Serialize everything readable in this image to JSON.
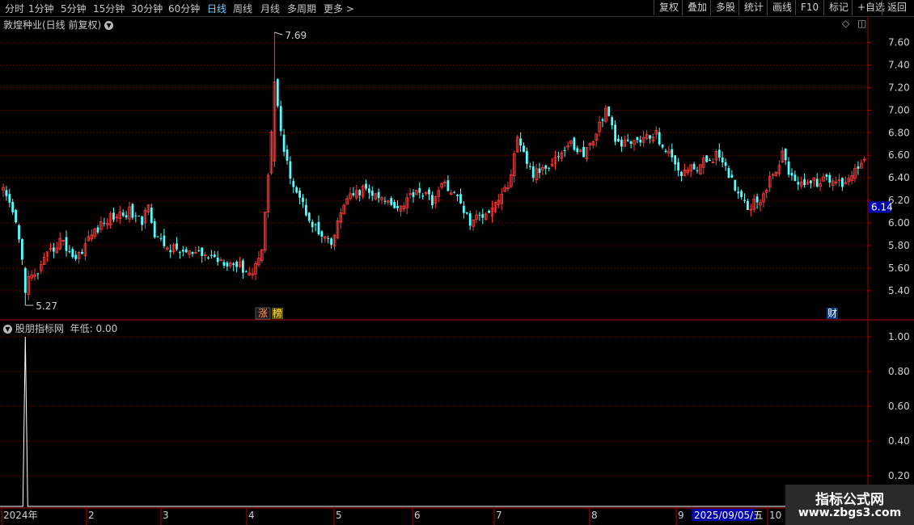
{
  "toolbar": {
    "periods": [
      "分时",
      "1分钟",
      "5分钟",
      "15分钟",
      "30分钟",
      "60分钟",
      "日线",
      "周线",
      "月线",
      "多周期",
      "更多 >"
    ],
    "active_period": "日线",
    "tools": [
      "复权",
      "叠加",
      "多股",
      "统计",
      "画线",
      "F10",
      "标记",
      "+自选",
      "返回"
    ]
  },
  "main_pane": {
    "title": "敦煌种业(日线 前复权)",
    "high_label": "7.69",
    "low_label": "5.27",
    "current_price": "6.14",
    "y_ticks": [
      "7.60",
      "7.40",
      "7.20",
      "7.00",
      "6.80",
      "6.60",
      "6.40",
      "6.20",
      "6.00",
      "5.80",
      "5.60",
      "5.40"
    ],
    "markers": {
      "zhang": "涨",
      "bang": "榜",
      "cai": "财"
    }
  },
  "indicator_pane": {
    "title": "股朋指标网",
    "line_label": "年低: 0.00",
    "y_ticks": [
      "1.00",
      "0.80",
      "0.60",
      "0.40",
      "0.20"
    ]
  },
  "x_axis": {
    "labels": [
      "2024年",
      "2",
      "3",
      "4",
      "5",
      "6",
      "7",
      "8",
      "9",
      "10"
    ],
    "cursor_date": "2025/09/05/五"
  },
  "watermark": {
    "line1": "指标公式网",
    "line2": "www.zbgs3.com"
  },
  "colors": {
    "up": "#ff3b3b",
    "down": "#54ffff",
    "axis": "#b00000",
    "grid": "#7a0000",
    "cursor_bg": "#0000b0"
  },
  "chart_data": {
    "type": "candlestick",
    "title": "敦煌种业(日线 前复权)",
    "ylim": [
      5.25,
      7.75
    ],
    "high": 7.69,
    "low": 5.27,
    "last": 6.14,
    "close_anchors": [
      [
        0,
        6.28
      ],
      [
        4,
        6.0
      ],
      [
        7,
        5.5
      ],
      [
        10,
        5.52
      ],
      [
        14,
        5.7
      ],
      [
        18,
        5.85
      ],
      [
        23,
        5.68
      ],
      [
        28,
        5.9
      ],
      [
        34,
        6.05
      ],
      [
        40,
        6.1
      ],
      [
        44,
        6.0
      ],
      [
        46,
        6.2
      ],
      [
        48,
        5.88
      ],
      [
        52,
        5.78
      ],
      [
        60,
        5.72
      ],
      [
        66,
        5.7
      ],
      [
        74,
        5.63
      ],
      [
        79,
        5.55
      ],
      [
        82,
        5.8
      ],
      [
        84,
        6.4
      ],
      [
        86,
        7.25
      ],
      [
        89,
        6.6
      ],
      [
        92,
        6.35
      ],
      [
        96,
        6.1
      ],
      [
        100,
        5.9
      ],
      [
        104,
        5.8
      ],
      [
        108,
        6.18
      ],
      [
        114,
        6.3
      ],
      [
        120,
        6.2
      ],
      [
        126,
        6.15
      ],
      [
        131,
        6.3
      ],
      [
        136,
        6.2
      ],
      [
        140,
        6.35
      ],
      [
        144,
        6.22
      ],
      [
        148,
        6.0
      ],
      [
        154,
        6.12
      ],
      [
        160,
        6.32
      ],
      [
        163,
        6.72
      ],
      [
        168,
        6.42
      ],
      [
        174,
        6.55
      ],
      [
        180,
        6.7
      ],
      [
        184,
        6.6
      ],
      [
        188,
        6.8
      ],
      [
        191,
        7.0
      ],
      [
        195,
        6.68
      ],
      [
        200,
        6.72
      ],
      [
        207,
        6.78
      ],
      [
        211,
        6.6
      ],
      [
        215,
        6.45
      ],
      [
        220,
        6.5
      ],
      [
        226,
        6.6
      ],
      [
        230,
        6.42
      ],
      [
        236,
        6.15
      ],
      [
        240,
        6.22
      ],
      [
        244,
        6.42
      ],
      [
        247,
        6.6
      ],
      [
        250,
        6.4
      ],
      [
        255,
        6.35
      ],
      [
        262,
        6.38
      ],
      [
        266,
        6.35
      ],
      [
        271,
        6.5
      ],
      [
        273,
        6.6
      ]
    ],
    "volume_series": {
      "name": "年低",
      "spike_index": 7,
      "spike_value": 1.0,
      "ylim": [
        0,
        1.05
      ]
    }
  }
}
